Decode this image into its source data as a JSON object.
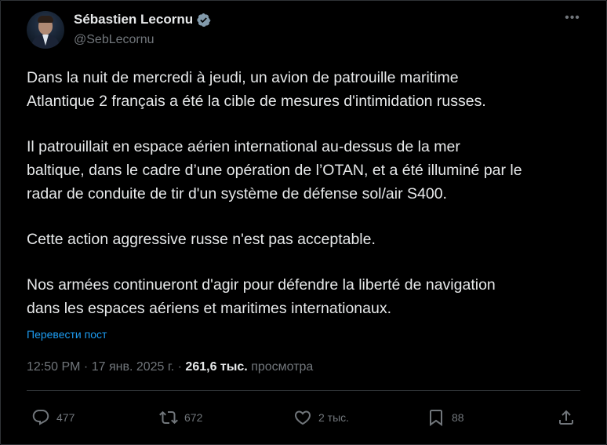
{
  "author": {
    "name": "Sébastien Lecornu",
    "handle": "@SebLecornu"
  },
  "post": {
    "paragraphs": [
      [
        "Dans la nuit de mercredi à jeudi, un avion de patrouille maritime",
        "Atlantique 2 français a été la cible de mesures d'intimidation russes."
      ],
      [
        "Il patrouillait en espace aérien international au-dessus de la mer",
        "baltique, dans le cadre d’une opération de l’OTAN, et a été illuminé par le",
        "radar de conduite de tir d'un système de défense sol/air S400."
      ],
      [
        "Cette action aggressive russe n'est pas acceptable."
      ],
      [
        "Nos armées continueront d'agir pour défendre la liberté de navigation",
        "dans les espaces aériens et maritimes internationaux."
      ]
    ],
    "translate_label": "Перевести пост"
  },
  "meta": {
    "time": "12:50 PM",
    "dot1": " · ",
    "date": "17 янв. 2025 г.",
    "dot2": " · ",
    "views_count": "261,6 тыс.",
    "views_label": " просмотра"
  },
  "actions": {
    "replies": "477",
    "reposts": "672",
    "likes": "2 тыс.",
    "bookmarks": "88"
  },
  "icons": {
    "verified": "verified-badge-icon",
    "more": "more-icon",
    "reply": "reply-icon",
    "repost": "repost-icon",
    "like": "like-icon",
    "bookmark": "bookmark-icon",
    "share": "share-icon"
  },
  "colors": {
    "background": "#000000",
    "text": "#e7e9ea",
    "secondary": "#71767b",
    "link": "#1d9bf0",
    "divider": "#2f3336"
  }
}
